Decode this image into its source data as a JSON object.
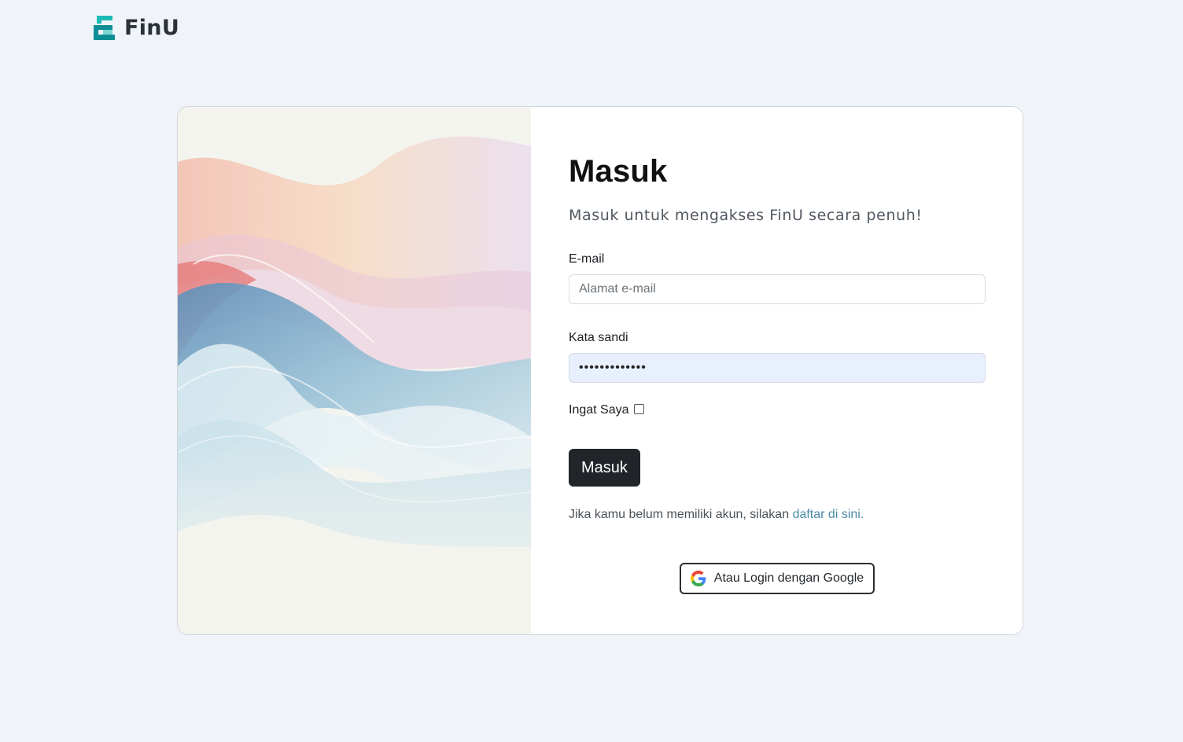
{
  "brand": {
    "name": "FinU"
  },
  "login": {
    "title": "Masuk",
    "subtitle": "Masuk untuk mengakses FinU secara penuh!",
    "email_label": "E-mail",
    "email_placeholder": "Alamat e-mail",
    "email_value": "",
    "password_label": "Kata sandi",
    "password_value": "•••••••••••••",
    "remember_label": "Ingat Saya",
    "remember_checked": false,
    "submit_label": "Masuk",
    "register_text": "Jika kamu belum memiliki akun, silakan",
    "register_link": "daftar di sini.",
    "google_label": "Atau Login dengan Google"
  },
  "colors": {
    "background": "#f0f4f8",
    "brand_teal": "#17a2a8",
    "submit_button": "#212529",
    "link": "#4a8aa8",
    "password_field_fill": "#e8f0fe"
  },
  "icons": {
    "logo": "finu-logo-icon",
    "google": "google-icon",
    "artwork": "abstract-wave-artwork"
  }
}
